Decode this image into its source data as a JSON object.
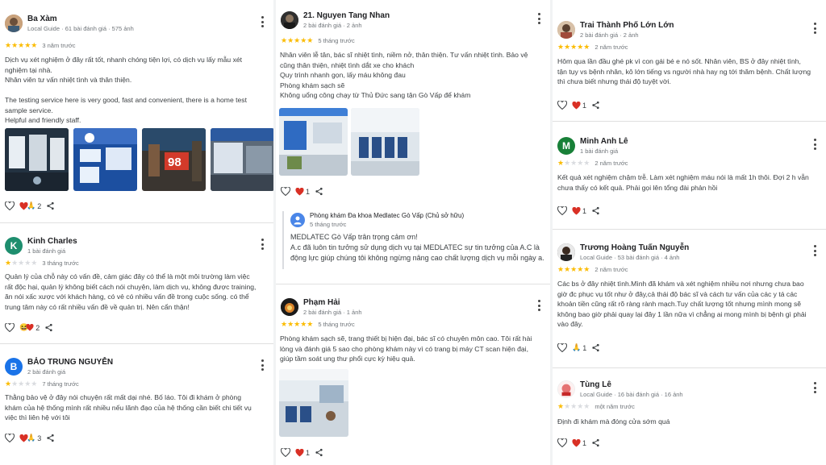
{
  "reviews": {
    "r1": {
      "name": "Ba Xàm",
      "meta": "Local Guide · 61 bài đánh giá · 575 ảnh",
      "when": "3 năm trước",
      "stars": 5,
      "lines": [
        "Dịch vụ xét nghiệm ở đây rất tốt, nhanh chóng tiện lợi, có dịch vụ lấy mẫu xét",
        "nghiệm tại nhà.",
        "Nhân viên tư vấn nhiệt tình và thân thiện.",
        "",
        "The testing service here is very good, fast and convenient, there is a home test",
        "sample service.",
        "Helpful and friendly staff."
      ],
      "reactions": "2",
      "photo_sign": "98"
    },
    "r2": {
      "name": "Kinh Charles",
      "initial": "K",
      "meta": "1 bài đánh giá",
      "when": "3 tháng trước",
      "stars": 1,
      "lines": [
        "Quản lý của chỗ này có vấn đề, cảm giác đây có thể là một môi trường làm việc",
        "rất độc hại, quản lý không biết cách nói chuyện, làm dịch vụ, không được training,",
        "ăn nói xấc xược với khách hàng, có vẻ có nhiều vấn đề trong cuộc sống. có thể",
        "trung tâm này có rất nhiều vấn đề về quản trị. Nên cẩn thận!"
      ],
      "reactions": "2"
    },
    "r3": {
      "name": "BẢO TRUNG NGUYỄN",
      "initial": "B",
      "meta": "2 bài đánh giá",
      "when": "7 tháng trước",
      "stars": 1,
      "lines": [
        "Thằng bảo vệ ở đây nói chuyện rất mất dại nhé. Bố láo. Tôi đi khám ở phòng",
        "khám của hệ thống mình rất nhiều nếu lãnh đạo của hệ thống cần biết chi tiết vụ",
        "việc thì liên hệ với tôi"
      ],
      "reactions": "3"
    },
    "r4": {
      "name": "21. Nguyen Tang Nhan",
      "meta": "2 bài đánh giá · 2 ảnh",
      "when": "5 tháng trước",
      "stars": 5,
      "lines": [
        "Nhân viên lễ tân, bác sĩ nhiệt tình, niềm nở, thân thiện. Tư vấn nhiệt tình. Bảo vệ",
        "cũng thân thiện, nhiệt tình dắt xe cho khách",
        "Quy trình nhanh gọn, lấy máu không đau",
        "Phòng khám sạch sẽ",
        "Không uổng công chạy từ Thủ Đức sang tận Gò Vấp để khám"
      ],
      "likes": "1",
      "owner": {
        "name": "Phòng khám Đa khoa Medlatec Gò Vấp (Chủ sở hữu)",
        "when": "5 tháng trước",
        "lines": [
          "MEDLATEC Gò Vấp trân trọng cảm ơn!",
          "A.c đã luôn tin tưởng sử dụng dịch vụ tại MEDLATEC sự tin tưởng của A.C là",
          "động lực giúp chúng tôi không ngừng nâng cao chất lượng dịch vụ mỗi ngày a."
        ]
      }
    },
    "r5": {
      "name": "Phạm Hải",
      "meta": "2 bài đánh giá · 1 ảnh",
      "when": "5 tháng trước",
      "stars": 5,
      "lines": [
        "Phòng khám sạch sẽ, trang thiết bị hiện đại, bác sĩ có chuyên môn cao. Tôi rất hài",
        "lòng và đánh giá 5 sao cho phòng khám này vì có trang bị máy CT scan hiện đại,",
        "giúp tầm soát ung thư phổi cực kỳ hiệu quả."
      ],
      "likes": "1"
    },
    "r6": {
      "name": "Trai Thành Phố Lớn Lớn",
      "meta": "2 bài đánh giá · 2 ảnh",
      "when": "2 năm trước",
      "stars": 5,
      "lines": [
        "Hôm qua lần đầu ghé pk vì con gái bé e nó sốt. Nhân viên, BS ở đây nhiệt tình,",
        "tận tụy vs bệnh nhân, kô lớn tiếng vs người nhà hay ng tới thăm bệnh. Chất lượng",
        "thì chưa biết nhưng thái độ tuyệt vời."
      ],
      "likes": "1"
    },
    "r7": {
      "name": "Minh Anh Lê",
      "initial": "M",
      "meta": "1 bài đánh giá",
      "when": "2 năm trước",
      "stars": 1,
      "lines": [
        "Kết quả xét nghiệm chậm trễ. Làm xét nghiệm máu nói là mất 1h thôi. Đợi 2 h vẫn",
        "chưa thấy có kết quả. Phải gọi lên tổng đài phản hồi"
      ],
      "likes": "1"
    },
    "r8": {
      "name": "Trương Hoàng Tuấn Nguyễn",
      "meta": "Local Guide · 53 bài đánh giá · 4 ảnh",
      "when": "2 năm trước",
      "stars": 5,
      "lines": [
        "Các bs ở đây nhiệt tình.Mình đã khám và xét nghiệm nhiều nơi nhưng chưa bao",
        "giờ đc phục vụ tốt như ở đây,cả thái độ bác sĩ và cách tư vấn của các y tá các",
        "khoản tiền cũng rất rõ ràng rành mạch.Tuy chất lượng tốt nhưng mình mong sẽ",
        "không bao giờ phải quay lại đây 1 lần nữa vì chẳng ai mong mình bị bệnh gì phải",
        "vào đây."
      ],
      "likes": "1"
    },
    "r9": {
      "name": "Tùng Lê",
      "meta": "Local Guide · 16 bài đánh giá · 16 ảnh",
      "when": "một năm trước",
      "stars": 1,
      "lines": [
        "Định đi khám mà đóng cửa sớm quá"
      ],
      "likes": "1"
    }
  },
  "colors": {
    "star": "#fbbc04",
    "heart": "#d93025",
    "k": "#1e8e6e",
    "b": "#1a73e8",
    "m": "#188038"
  }
}
